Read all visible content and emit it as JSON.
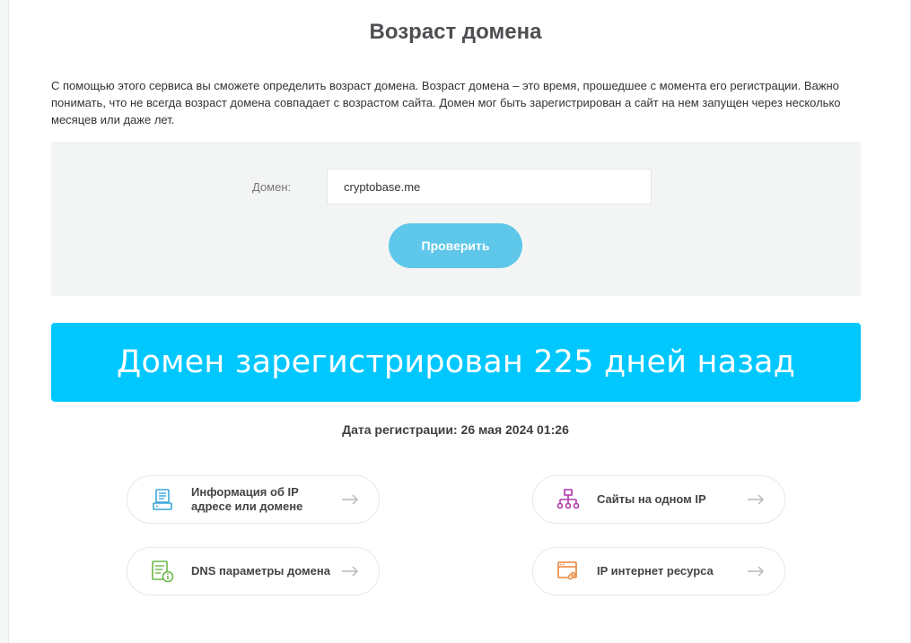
{
  "page": {
    "title": "Возраст домена",
    "intro": "С помощью этого сервиса вы сможете определить возраст домена. Возраст домена – это время, прошедшее с момента его регистрации. Важно понимать, что не всегда возраст домена совпадает с возрастом сайта. Домен мог быть зарегистрирован а сайт на нем запущен через несколько месяцев или даже лет."
  },
  "form": {
    "domain_label": "Домен:",
    "domain_value": "cryptobase.me",
    "check_button": "Проверить"
  },
  "result": {
    "banner": "Домен зарегистрирован 225 дней назад",
    "registration_date": "Дата регистрации: 26 мая 2024 01:26"
  },
  "links": [
    {
      "label": "Информация об IP адресе или домене",
      "icon": "server-info-icon",
      "color": "#3aa6d8"
    },
    {
      "label": "Сайты на одном IP",
      "icon": "sitemap-icon",
      "color": "#b03ab0"
    },
    {
      "label": "DNS параметры домена",
      "icon": "dns-settings-icon",
      "color": "#6cb84a"
    },
    {
      "label": "IP интернет ресурса",
      "icon": "browser-link-icon",
      "color": "#e8843a"
    }
  ],
  "colors": {
    "accent_button": "#5ec7ea",
    "result_banner": "#00c8ff",
    "panel_bg": "#f3f5f5"
  }
}
